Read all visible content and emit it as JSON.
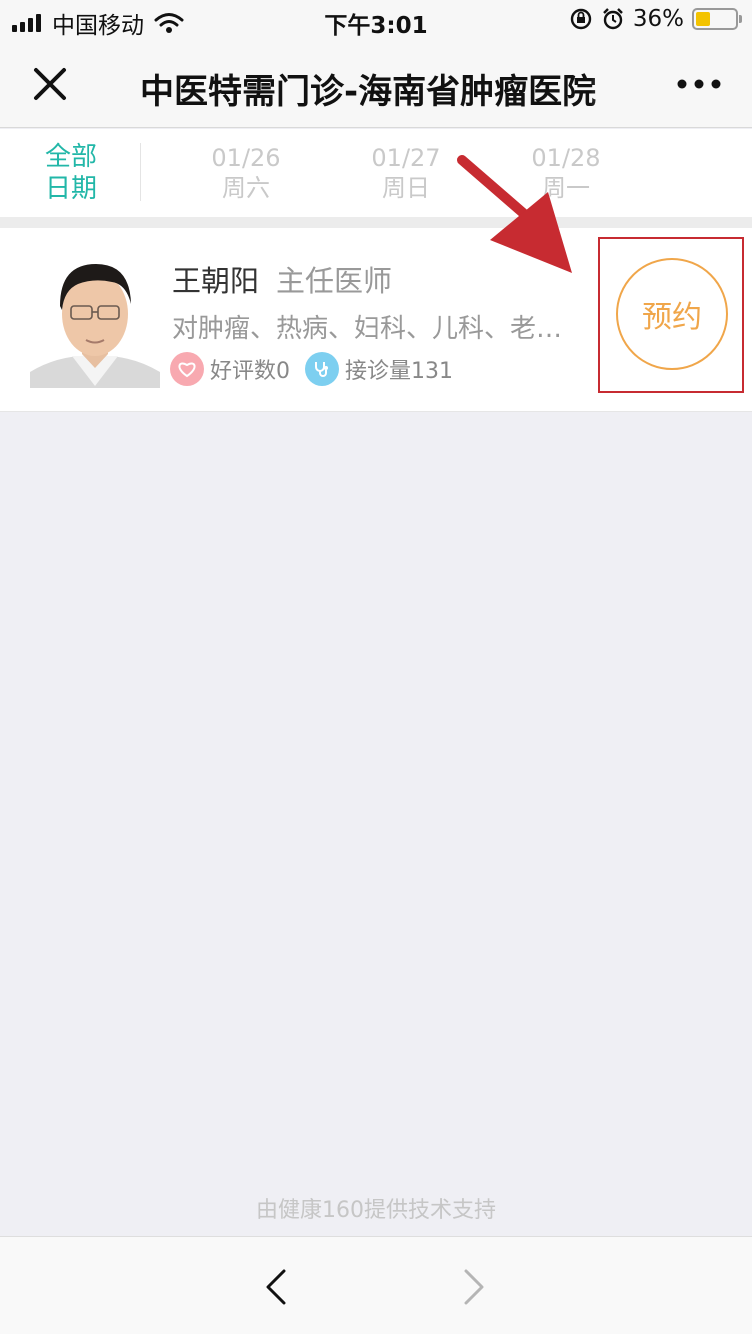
{
  "status_bar": {
    "carrier": "中国移动",
    "time": "下午3:01",
    "battery_percent": "36%",
    "battery_level": 0.36,
    "icons": [
      "signal-icon",
      "wifi-icon",
      "rotation-lock-icon",
      "alarm-icon",
      "battery-icon"
    ]
  },
  "nav": {
    "title": "中医特需门诊-海南省肿瘤医院",
    "close_icon": "close-icon",
    "more_icon": "more-icon"
  },
  "date_tabs": {
    "all": {
      "line1": "全部",
      "line2": "日期"
    },
    "dates": [
      {
        "date": "01/26",
        "weekday": "周六"
      },
      {
        "date": "01/27",
        "weekday": "周日"
      },
      {
        "date": "01/28",
        "weekday": "周一"
      }
    ],
    "active_color": "#22b7a8",
    "inactive_color": "#c9c9c9"
  },
  "doctor": {
    "name": "王朝阳",
    "title": "主任医师",
    "specialty": "对肿瘤、热病、妇科、儿科、老…",
    "reviews_label": "好评数0",
    "visits_label": "接诊量131",
    "book_label": "预约",
    "book_color": "#f0a64a"
  },
  "annotation": {
    "arrow_color": "#c72b31",
    "box_color": "#c72b31"
  },
  "footer": {
    "text": "由健康160提供技术支持"
  },
  "bottom_nav": {
    "back_icon": "back-icon",
    "forward_icon": "forward-icon"
  }
}
